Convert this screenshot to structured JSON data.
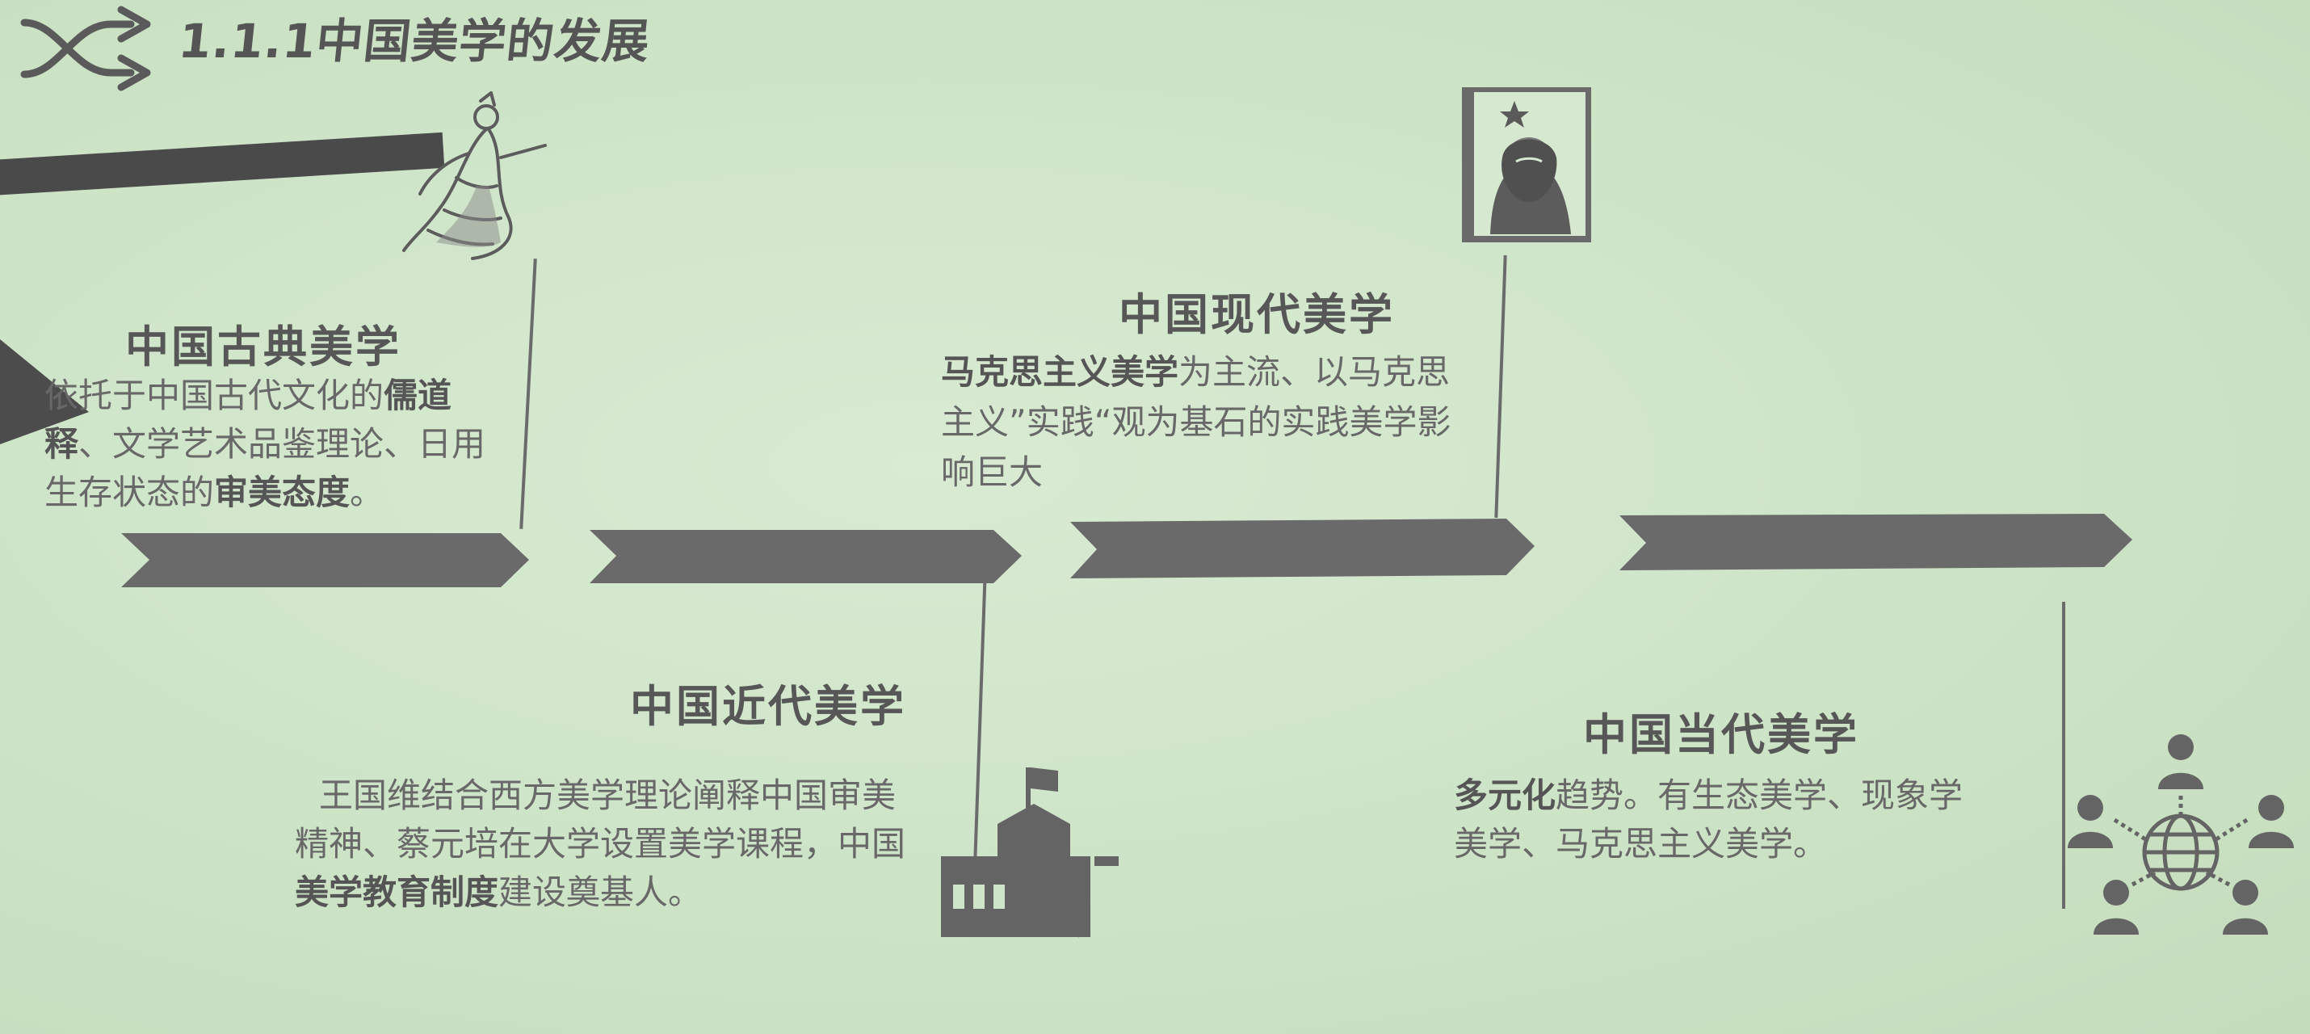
{
  "header": {
    "title": "1.1.1中国美学的发展",
    "icon": "shuffle-arrows-icon"
  },
  "periods": [
    {
      "title": "中国古典美学",
      "desc_pre": "依托于中国古代文化的",
      "desc_bold1": "儒道释",
      "desc_mid": "、文学艺术品鉴理论、日用生存状态的",
      "desc_bold2": "审美态度",
      "desc_end": "。",
      "icon": "ancient-sage-figure-icon"
    },
    {
      "title": "中国近代美学",
      "desc_pre": "王国维结合西方美学理论阐释中国审美精神、蔡元培在大学设置美学课程，中国",
      "desc_bold1": "美学教育制度",
      "desc_end": "建设奠基人。",
      "icon": "university-books-icon"
    },
    {
      "title": "中国现代美学",
      "desc_bold1": "马克思主义美学",
      "desc_mid": "为主流、以马克思主义”实践“观为基石的实践美学影响巨大",
      "icon": "marx-portrait-book-icon"
    },
    {
      "title": "中国当代美学",
      "desc_bold1": "多元化",
      "desc_mid": "趋势。有生态美学、现象学美学、马克思主义美学。",
      "icon": "global-network-people-icon"
    }
  ],
  "colors": {
    "background": "#cfe5c9",
    "timeline": "#6a6a6a",
    "text": "#5f5f5f"
  }
}
